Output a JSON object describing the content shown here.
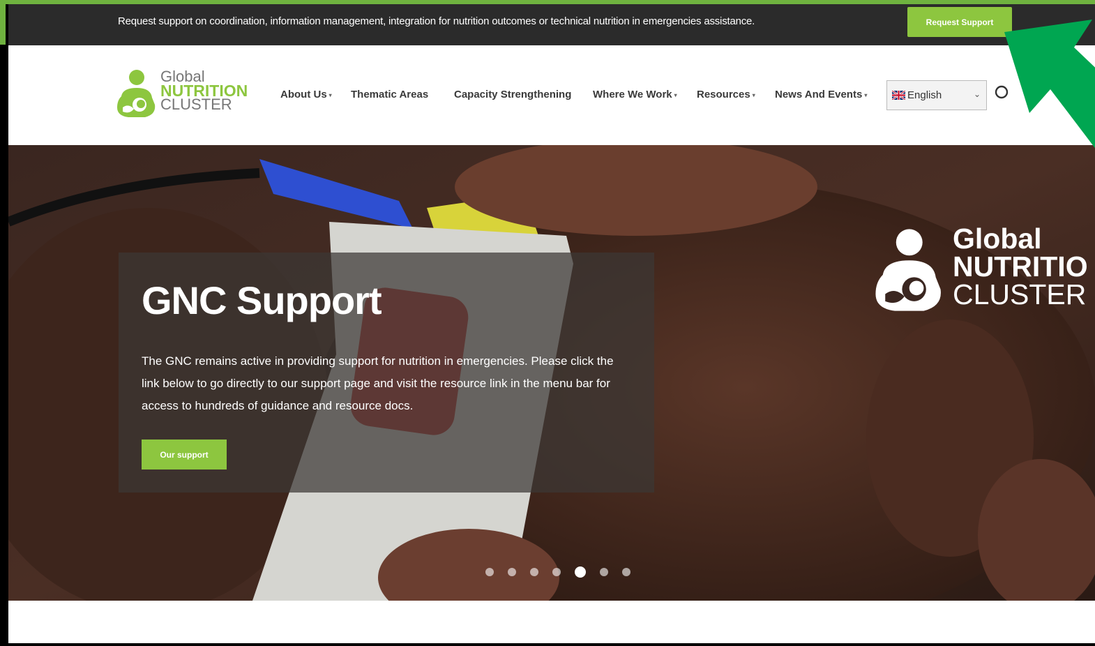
{
  "topbar": {
    "message": "Request support on coordination, information management, integration for nutrition outcomes or technical nutrition in emergencies assistance.",
    "request_button": "Request Support"
  },
  "logo": {
    "line1": "Global",
    "line2": "NUTRITION",
    "line3": "CLUSTER"
  },
  "nav": {
    "items": [
      {
        "label": "About Us",
        "dropdown": true
      },
      {
        "label": "Thematic Areas",
        "dropdown": false
      },
      {
        "label": "Capacity Strengthening",
        "dropdown": false
      },
      {
        "label": "Where We Work",
        "dropdown": true
      },
      {
        "label": "Resources",
        "dropdown": true
      },
      {
        "label": "News And Events",
        "dropdown": true
      }
    ],
    "language": "English",
    "search_icon": "search-icon"
  },
  "hero": {
    "title": "GNC Support",
    "body": "The GNC remains active in providing support for nutrition in emergencies. Please click the link below to go directly to our support page and visit the resource link in the menu bar for access to hundreds of guidance and resource docs.",
    "button": "Our support",
    "logo_line1": "Global",
    "logo_line2": "NUTRITIO",
    "logo_line3": "CLUSTER",
    "slides": 7,
    "active_slide": 5
  },
  "colors": {
    "accent": "#8dc63f",
    "topbar": "#2b2b2b",
    "arrow": "#00a651"
  }
}
